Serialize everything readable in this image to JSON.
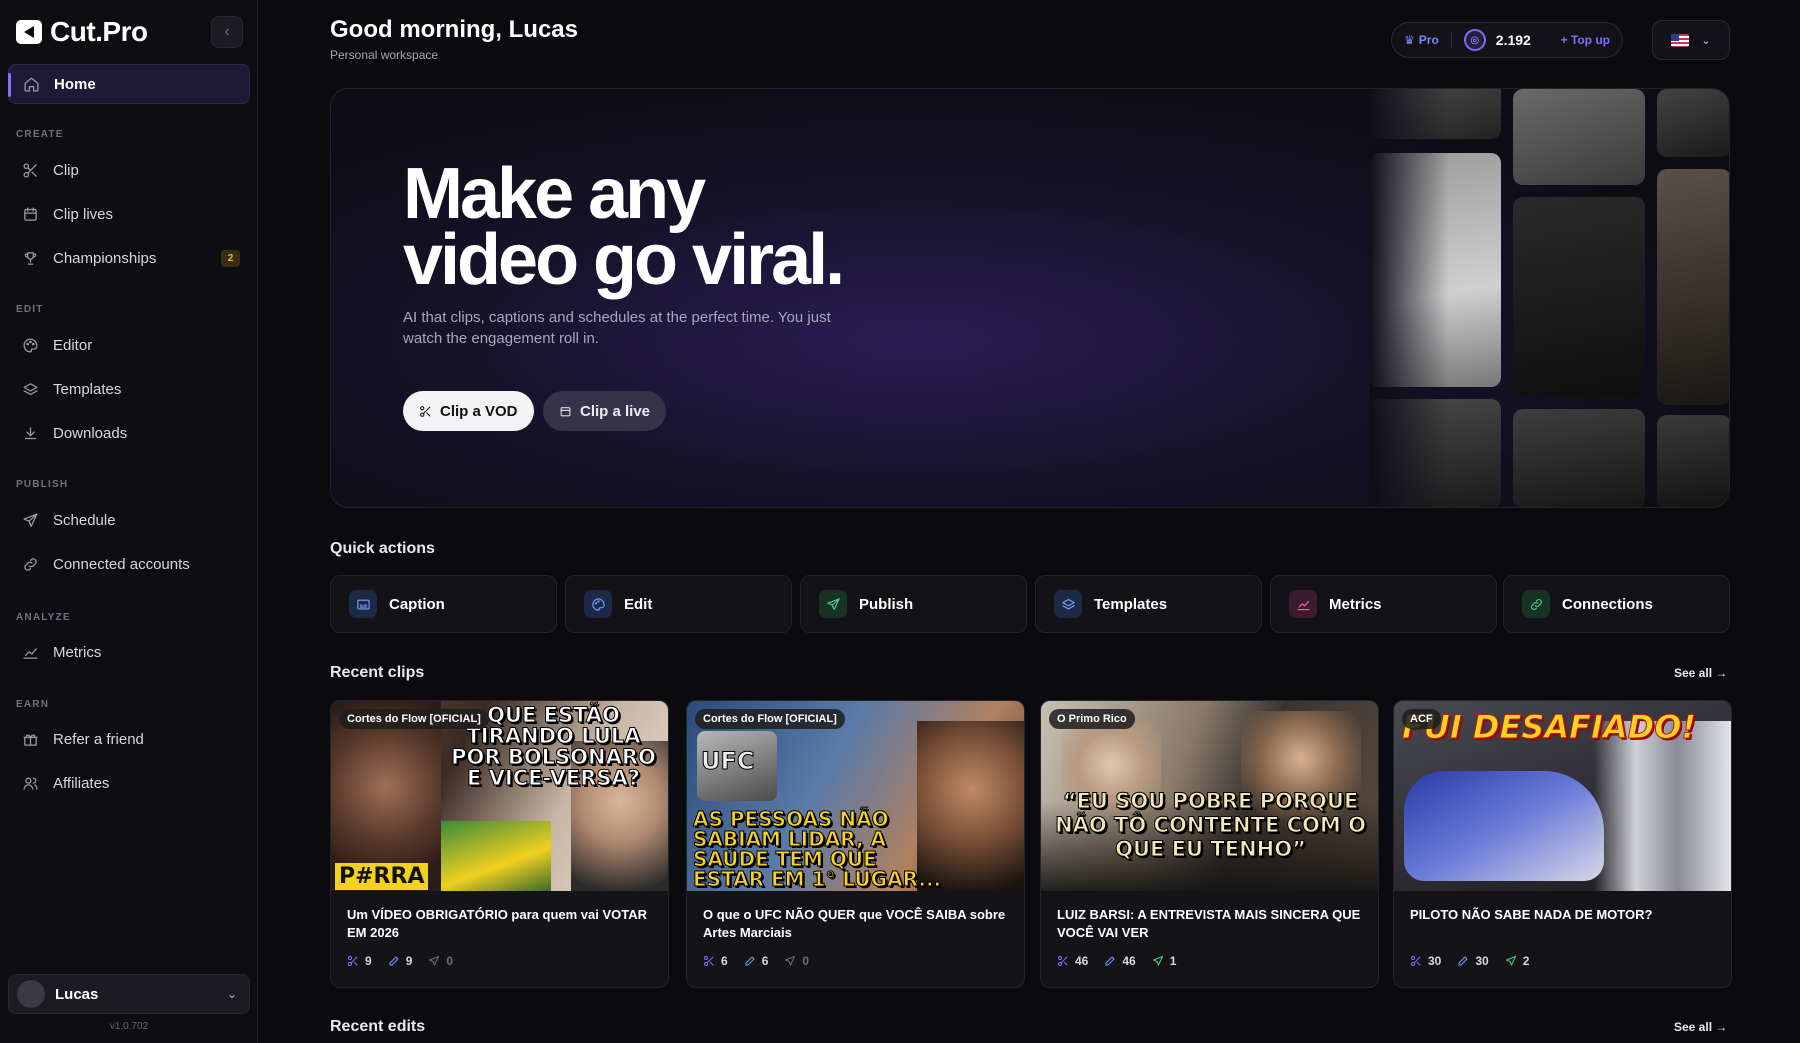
{
  "app": {
    "logo_text": "Cut.Pro",
    "version": "v1.0.702"
  },
  "sidebar": {
    "home_label": "Home",
    "sections": {
      "create": "CREATE",
      "edit": "EDIT",
      "publish": "PUBLISH",
      "analyze": "ANALYZE",
      "earn": "EARN"
    },
    "items": {
      "clip": "Clip",
      "clip_lives": "Clip lives",
      "championships": "Championships",
      "championships_badge": "2",
      "editor": "Editor",
      "templates": "Templates",
      "downloads": "Downloads",
      "schedule": "Schedule",
      "connected_accounts": "Connected accounts",
      "metrics": "Metrics",
      "refer": "Refer a friend",
      "affiliates": "Affiliates"
    },
    "user": {
      "name": "Lucas"
    }
  },
  "header": {
    "greeting": "Good morning, Lucas",
    "workspace": "Personal workspace",
    "plan": "Pro",
    "credits": "2.192",
    "topup": "+ Top up"
  },
  "hero": {
    "title_line1": "Make any",
    "title_line2": "video go viral.",
    "subtitle": "AI that clips, captions and schedules at the perfect time. You just watch the engagement roll in.",
    "primary_button": "Clip a VOD",
    "secondary_button": "Clip a live"
  },
  "quick_actions": {
    "title": "Quick actions",
    "items": [
      "Caption",
      "Edit",
      "Publish",
      "Templates",
      "Metrics",
      "Connections"
    ]
  },
  "recent_clips": {
    "title": "Recent clips",
    "see_all": "See all →",
    "cards": [
      {
        "channel": "Cortes do Flow [OFICIAL]",
        "title": "Um VÍDEO OBRIGATÓRIO para quem vai VOTAR EM 2026",
        "clips": "9",
        "edits": "9",
        "published": "0",
        "thumb_text": "QUE ESTÃO TIRANDO LULA POR BOLSONARO E VICE-VERSA?",
        "thumb_tag": "P#RRA"
      },
      {
        "channel": "Cortes do Flow [OFICIAL]",
        "title": "O que o UFC NÃO QUER que VOCÊ SAIBA sobre Artes Marciais",
        "clips": "6",
        "edits": "6",
        "published": "0",
        "thumb_text": "AS PESSOAS NÃO SABIAM LIDAR, A SAÚDE TEM QUE ESTAR EM 1° LUGAR...",
        "thumb_tag": "UFC"
      },
      {
        "channel": "O Primo Rico",
        "title": "LUIZ BARSI: A ENTREVISTA MAIS SINCERA QUE VOCÊ VAI VER",
        "clips": "46",
        "edits": "46",
        "published": "1",
        "thumb_text": "“EU SOU POBRE PORQUE NÃO TÔ CONTENTE COM O QUE EU TENHO”"
      },
      {
        "channel": "ACF",
        "title": "PILOTO NÃO SABE NADA DE MOTOR?",
        "clips": "30",
        "edits": "30",
        "published": "2",
        "thumb_text": "FUI DESAFIADO!"
      }
    ]
  },
  "recent_edits": {
    "title": "Recent edits",
    "see_all": "See all →"
  },
  "colors": {
    "accent": "#8b6cff",
    "topup": "#7b72ff",
    "pro": "#6f8bff",
    "badge": "#e8b64a"
  }
}
